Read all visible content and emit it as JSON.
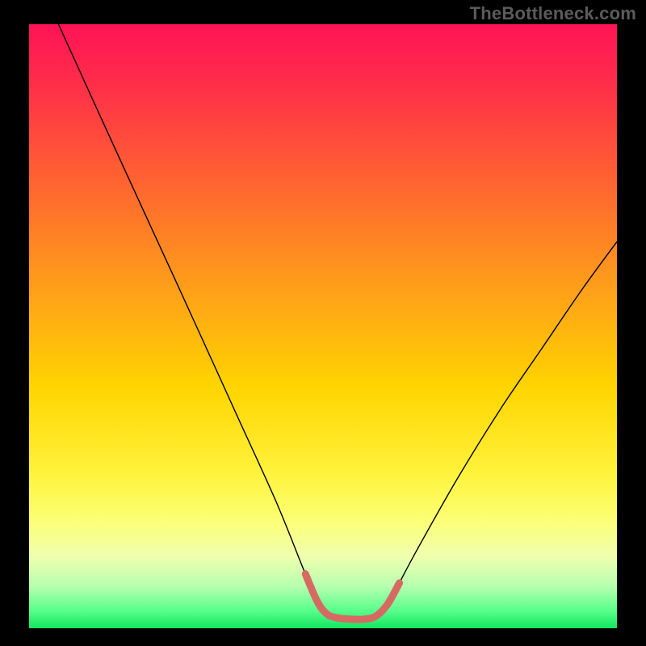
{
  "watermark": "TheBottleneck.com",
  "chart_data": {
    "type": "line",
    "title": "",
    "xlabel": "",
    "ylabel": "",
    "xlim": [
      0,
      1
    ],
    "ylim": [
      0,
      1
    ],
    "grid": false,
    "gradient_stops": [
      {
        "pos": 0.0,
        "color": "#ff1356"
      },
      {
        "pos": 0.1,
        "color": "#ff2e49"
      },
      {
        "pos": 0.28,
        "color": "#ff6a2e"
      },
      {
        "pos": 0.45,
        "color": "#ffa318"
      },
      {
        "pos": 0.6,
        "color": "#ffd400"
      },
      {
        "pos": 0.74,
        "color": "#fff23a"
      },
      {
        "pos": 0.82,
        "color": "#fcff74"
      },
      {
        "pos": 0.88,
        "color": "#f0ffad"
      },
      {
        "pos": 0.93,
        "color": "#b7ffb0"
      },
      {
        "pos": 0.97,
        "color": "#5bff8c"
      },
      {
        "pos": 1.0,
        "color": "#12e760"
      }
    ],
    "series": [
      {
        "name": "bottleneck-curve",
        "color": "#000000",
        "width": 1.4,
        "points": [
          {
            "x": 0.05,
            "y": 1.0
          },
          {
            "x": 0.12,
            "y": 0.85
          },
          {
            "x": 0.2,
            "y": 0.68
          },
          {
            "x": 0.28,
            "y": 0.51
          },
          {
            "x": 0.35,
            "y": 0.36
          },
          {
            "x": 0.42,
            "y": 0.21
          },
          {
            "x": 0.47,
            "y": 0.09
          },
          {
            "x": 0.495,
            "y": 0.035
          },
          {
            "x": 0.51,
            "y": 0.02
          },
          {
            "x": 0.54,
            "y": 0.015
          },
          {
            "x": 0.57,
            "y": 0.015
          },
          {
            "x": 0.59,
            "y": 0.02
          },
          {
            "x": 0.61,
            "y": 0.04
          },
          {
            "x": 0.66,
            "y": 0.13
          },
          {
            "x": 0.73,
            "y": 0.25
          },
          {
            "x": 0.8,
            "y": 0.36
          },
          {
            "x": 0.87,
            "y": 0.46
          },
          {
            "x": 0.94,
            "y": 0.56
          },
          {
            "x": 1.0,
            "y": 0.64
          }
        ]
      },
      {
        "name": "trough-highlight",
        "color": "#d66a63",
        "width": 9,
        "linecap": "round",
        "points": [
          {
            "x": 0.47,
            "y": 0.09
          },
          {
            "x": 0.49,
            "y": 0.045
          },
          {
            "x": 0.505,
            "y": 0.025
          },
          {
            "x": 0.52,
            "y": 0.018
          },
          {
            "x": 0.545,
            "y": 0.015
          },
          {
            "x": 0.57,
            "y": 0.015
          },
          {
            "x": 0.59,
            "y": 0.02
          },
          {
            "x": 0.61,
            "y": 0.04
          },
          {
            "x": 0.63,
            "y": 0.075
          }
        ]
      }
    ]
  }
}
